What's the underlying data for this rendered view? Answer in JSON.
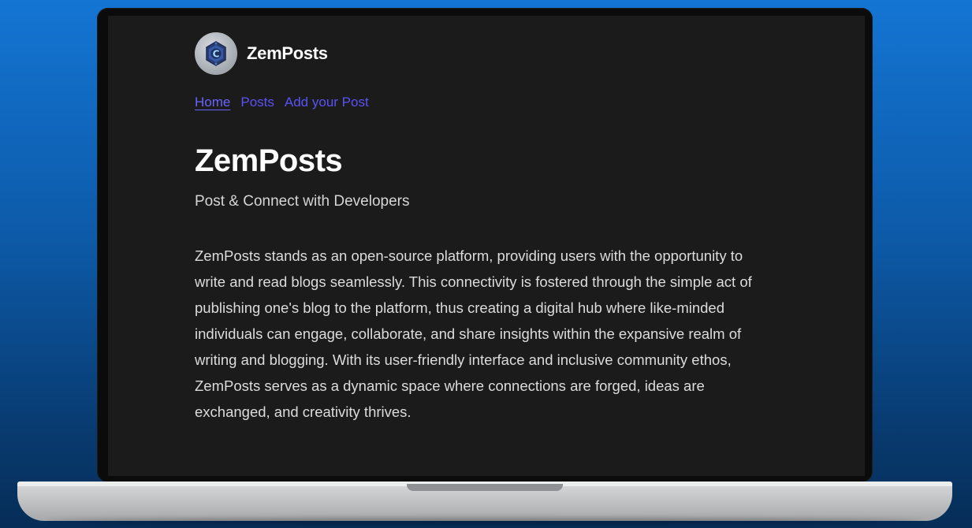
{
  "site": {
    "brand_name": "ZemPosts",
    "logo_icon": "zemposts-logo-icon"
  },
  "nav": {
    "items": [
      {
        "label": "Home",
        "active": true
      },
      {
        "label": "Posts",
        "active": false
      },
      {
        "label": "Add your Post",
        "active": false
      }
    ]
  },
  "hero": {
    "title": "ZemPosts",
    "subtitle": "Post & Connect with Developers",
    "description": "ZemPosts stands as an open-source platform, providing users with the opportunity to write and read blogs seamlessly. This connectivity is fostered through the simple act of publishing one's blog to the platform, thus creating a digital hub where like-minded individuals can engage, collaborate, and share insights within the expansive realm of writing and blogging. With its user-friendly interface and inclusive community ethos, ZemPosts serves as a dynamic space where connections are forged, ideas are exchanged, and creativity thrives."
  },
  "colors": {
    "background_top": "#1475d3",
    "screen_background": "#1b1b1b",
    "nav_link": "#5a52f5",
    "text_primary": "#ffffff",
    "text_body": "#dcdcdc"
  }
}
